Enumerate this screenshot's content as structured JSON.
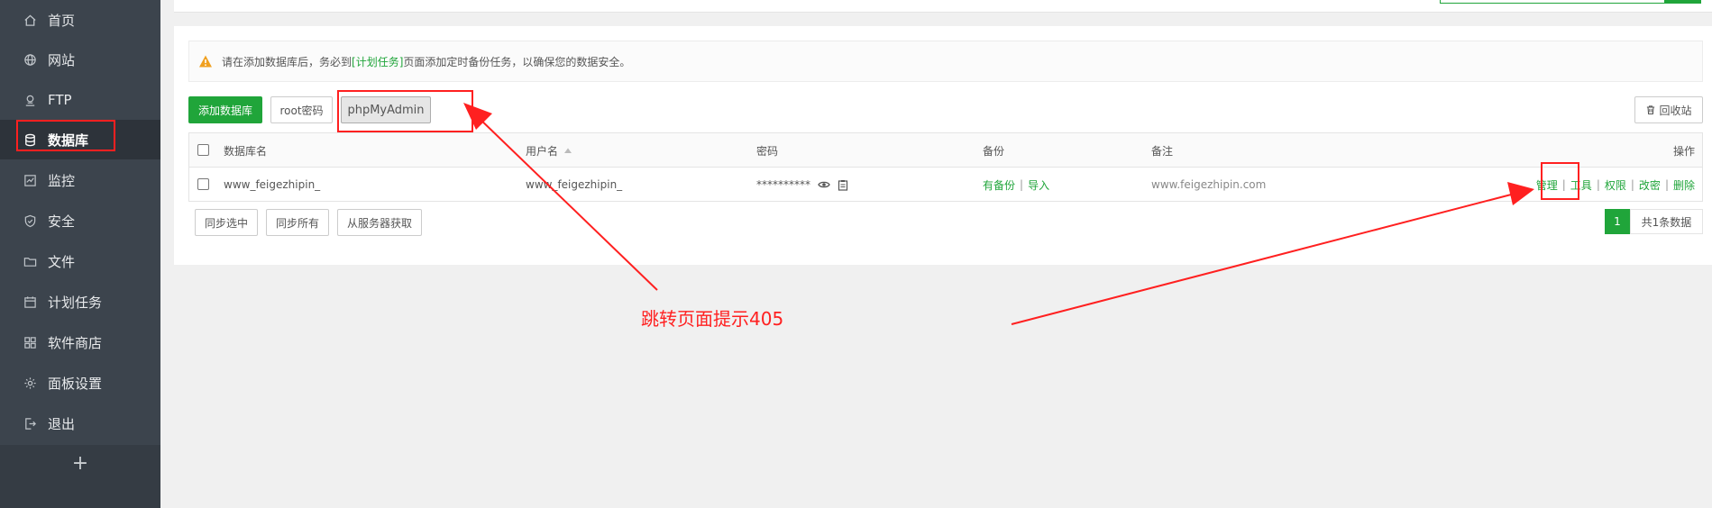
{
  "sidebar": {
    "items": [
      {
        "label": "首页",
        "icon": "home-icon"
      },
      {
        "label": "网站",
        "icon": "globe-icon"
      },
      {
        "label": "FTP",
        "icon": "ftp-icon"
      },
      {
        "label": "数据库",
        "icon": "database-icon",
        "active": true
      },
      {
        "label": "监控",
        "icon": "monitor-icon"
      },
      {
        "label": "安全",
        "icon": "shield-icon"
      },
      {
        "label": "文件",
        "icon": "folder-icon"
      },
      {
        "label": "计划任务",
        "icon": "calendar-icon"
      },
      {
        "label": "软件商店",
        "icon": "grid-icon"
      },
      {
        "label": "面板设置",
        "icon": "gear-icon"
      },
      {
        "label": "退出",
        "icon": "logout-icon"
      }
    ],
    "add_label": "+"
  },
  "alert": {
    "prefix": "请在添加数据库后，务必到",
    "link": "[计划任务]",
    "suffix": "页面添加定时备份任务，以确保您的数据安全。",
    "icon": "warning-icon"
  },
  "toolbar": {
    "add_db": "添加数据库",
    "root_password": "root密码",
    "phpmyadmin": "phpMyAdmin",
    "recycle_bin": "回收站"
  },
  "table": {
    "columns": {
      "name": "数据库名",
      "user": "用户名",
      "password": "密码",
      "backup": "备份",
      "note": "备注",
      "ops": "操作"
    },
    "rows": [
      {
        "name": "www_feigezhipin_",
        "user": "www_feigezhipin_",
        "password": "**********",
        "backup": "有备份",
        "import": "导入",
        "note": "www.feigezhipin.com",
        "ops": {
          "manage": "管理",
          "tools": "工具",
          "perm": "权限",
          "change_pwd": "改密",
          "delete": "删除"
        }
      }
    ]
  },
  "footer": {
    "sync_selected": "同步选中",
    "sync_all": "同步所有",
    "fetch_server": "从服务器获取",
    "page": "1",
    "total": "共1条数据"
  },
  "annotation": {
    "text": "跳转页面提示405",
    "color": "#ff2020"
  },
  "colors": {
    "accent": "#20a53a",
    "sidebar_bg": "#3c444d"
  }
}
